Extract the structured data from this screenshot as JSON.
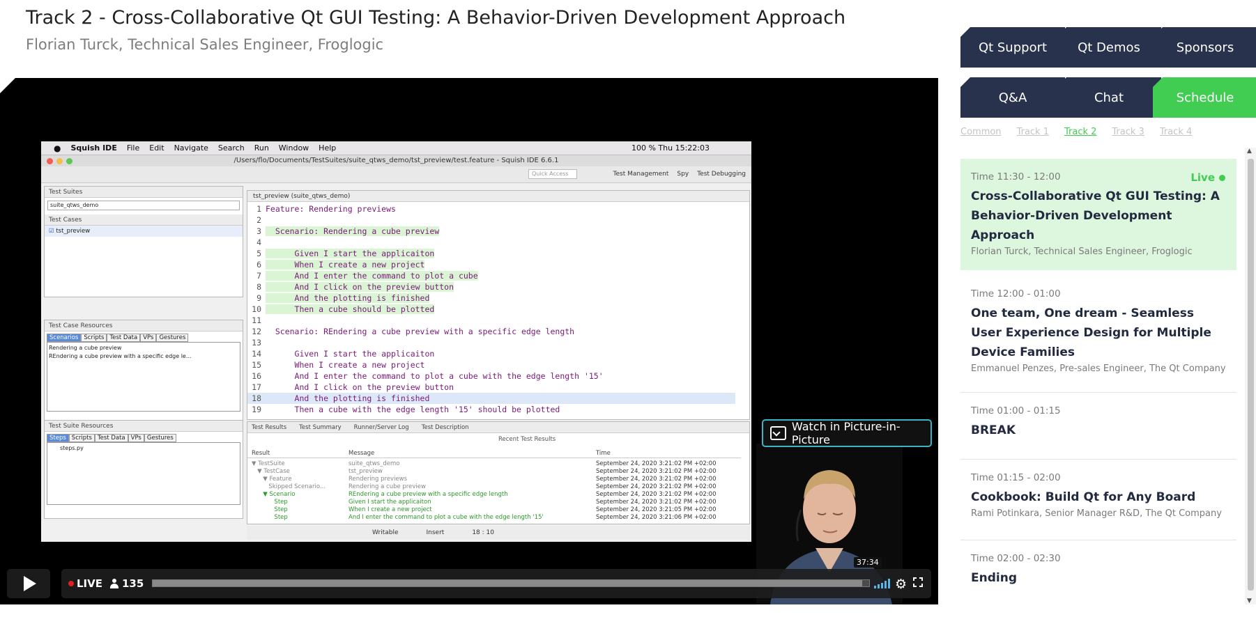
{
  "talk": {
    "title": "Track 2 - Cross-Collaborative Qt GUI Testing: A Behavior-Driven Development Approach",
    "subtitle": "Florian Turck, Technical Sales Engineer, Froglogic"
  },
  "ide": {
    "menu": [
      "Squish IDE",
      "File",
      "Edit",
      "Navigate",
      "Search",
      "Run",
      "Window",
      "Help"
    ],
    "clock": "100 %  Thu 15:22:03",
    "path": "/Users/flo/Documents/TestSuites/suite_qtws_demo/tst_preview/test.feature - Squish IDE 6.6.1",
    "quick_access": "Quick Access",
    "toolbar_right": [
      "Test Management",
      "Spy",
      "Test Debugging"
    ],
    "test_suites_label": "Test Suites",
    "suite_name": "suite_qtws_demo",
    "test_cases_label": "Test Cases",
    "test_case": "tst_preview",
    "resources_label": "Test Case Resources",
    "resource_tabs": [
      "Scenarios",
      "Scripts",
      "Test Data",
      "VPs",
      "Gestures"
    ],
    "scenarios": [
      "Rendering a cube preview",
      "REndering a cube preview with a specific edge le..."
    ],
    "suite_resources_label": "Test Suite Resources",
    "suite_resource_tabs": [
      "Steps",
      "Scripts",
      "Test Data",
      "VPs",
      "Gestures"
    ],
    "steps_file": "steps.py",
    "editor_tab": "tst_preview (suite_qtws_demo)",
    "code": [
      {
        "n": "1",
        "t": "Feature: Rendering previews",
        "cls": ""
      },
      {
        "n": "2",
        "t": "",
        "cls": ""
      },
      {
        "n": "3",
        "t": "  Scenario: Rendering a cube preview",
        "cls": "green"
      },
      {
        "n": "4",
        "t": "",
        "cls": ""
      },
      {
        "n": "5",
        "t": "      Given I start the applicaiton",
        "cls": "green"
      },
      {
        "n": "6",
        "t": "      When I create a new project",
        "cls": "green"
      },
      {
        "n": "7",
        "t": "      And I enter the command to plot a cube",
        "cls": "green"
      },
      {
        "n": "8",
        "t": "      And I click on the preview button",
        "cls": "green"
      },
      {
        "n": "9",
        "t": "      And the plotting is finished",
        "cls": "green"
      },
      {
        "n": "10",
        "t": "      Then a cube should be plotted",
        "cls": "green"
      },
      {
        "n": "11",
        "t": "",
        "cls": ""
      },
      {
        "n": "12",
        "t": "  Scenario: REndering a cube preview with a specific edge length",
        "cls": ""
      },
      {
        "n": "13",
        "t": "",
        "cls": ""
      },
      {
        "n": "14",
        "t": "      Given I start the applicaiton",
        "cls": ""
      },
      {
        "n": "15",
        "t": "      When I create a new project",
        "cls": ""
      },
      {
        "n": "16",
        "t": "      And I enter the command to plot a cube with the edge length '15'",
        "cls": ""
      },
      {
        "n": "17",
        "t": "      And I click on the preview button",
        "cls": ""
      },
      {
        "n": "18",
        "t": "      And the plotting is finished",
        "cls": "sel"
      },
      {
        "n": "19",
        "t": "      Then a cube with the edge length '15' should be plotted",
        "cls": ""
      }
    ],
    "results_tabs": [
      "Test Results",
      "Test Summary",
      "Runner/Server Log",
      "Test Description"
    ],
    "recent_label": "Recent Test Results",
    "results_headers": [
      "Result",
      "Message",
      "Time"
    ],
    "results": [
      {
        "r": "▼ TestSuite",
        "m": "suite_qtws_demo",
        "t": "September 24, 2020 3:21:02 PM +02:00",
        "cls": ""
      },
      {
        "r": "   ▼ TestCase",
        "m": "tst_preview",
        "t": "September 24, 2020 3:21:02 PM +02:00",
        "cls": ""
      },
      {
        "r": "      ▼ Feature",
        "m": "Rendering previews",
        "t": "September 24, 2020 3:21:02 PM +02:00",
        "cls": ""
      },
      {
        "r": "         Skipped Scenario...",
        "m": "Rendering a cube preview",
        "t": "September 24, 2020 3:21:02 PM +02:00",
        "cls": ""
      },
      {
        "r": "      ▼ Scenario",
        "m": "REndering a cube preview with a specific edge length",
        "t": "September 24, 2020 3:21:02 PM +02:00",
        "cls": "green"
      },
      {
        "r": "            Step",
        "m": "Given I start the applicaiton",
        "t": "September 24, 2020 3:21:02 PM +02:00",
        "cls": "green"
      },
      {
        "r": "            Step",
        "m": "When I create a new project",
        "t": "September 24, 2020 3:21:05 PM +02:00",
        "cls": "green"
      },
      {
        "r": "            Step",
        "m": "And I enter the command to plot a cube with the edge length '15'",
        "t": "September 24, 2020 3:21:06 PM +02:00",
        "cls": "green"
      }
    ],
    "status": [
      "Writable",
      "Insert",
      "18 : 10"
    ]
  },
  "player": {
    "pip_label": "Watch in Picture-in-Picture",
    "live_label": "LIVE",
    "viewers": "135",
    "time_tooltip": "37:34",
    "progress_pct": 99
  },
  "tabs_row1": [
    {
      "label": "Qt Support",
      "active": false
    },
    {
      "label": "Qt Demos",
      "active": false
    },
    {
      "label": "Sponsors",
      "active": false
    }
  ],
  "tabs_row2": [
    {
      "label": "Q&A",
      "active": false
    },
    {
      "label": "Chat",
      "active": false
    },
    {
      "label": "Schedule",
      "active": true
    }
  ],
  "tracks": [
    {
      "label": "Common",
      "active": false
    },
    {
      "label": "Track 1",
      "active": false
    },
    {
      "label": "Track 2",
      "active": true
    },
    {
      "label": "Track 3",
      "active": false
    },
    {
      "label": "Track 4",
      "active": false
    }
  ],
  "schedule": [
    {
      "time": "Time 11:30 - 12:00",
      "title": "Cross-Collaborative Qt GUI Testing: A Behavior-Driven Development Approach",
      "speaker": "Florian Turck, Technical Sales Engineer, Froglogic",
      "live": "Live"
    },
    {
      "time": "Time 12:00 - 01:00",
      "title": "One team, One dream - Seamless User Experience Design for Multiple Device Families",
      "speaker": "Emmanuel Penzes, Pre-sales Engineer, The Qt Company",
      "live": ""
    },
    {
      "time": "Time 01:00 - 01:15",
      "title": "BREAK",
      "speaker": "",
      "live": ""
    },
    {
      "time": "Time 01:15 - 02:00",
      "title": "Cookbook: Build Qt for Any Board",
      "speaker": "Rami Potinkara, Senior Manager R&D, The Qt Company",
      "live": ""
    },
    {
      "time": "Time 02:00 - 02:30",
      "title": "Ending",
      "speaker": "",
      "live": ""
    }
  ],
  "colors": {
    "accent": "#41cd52",
    "navy": "#28324d"
  }
}
